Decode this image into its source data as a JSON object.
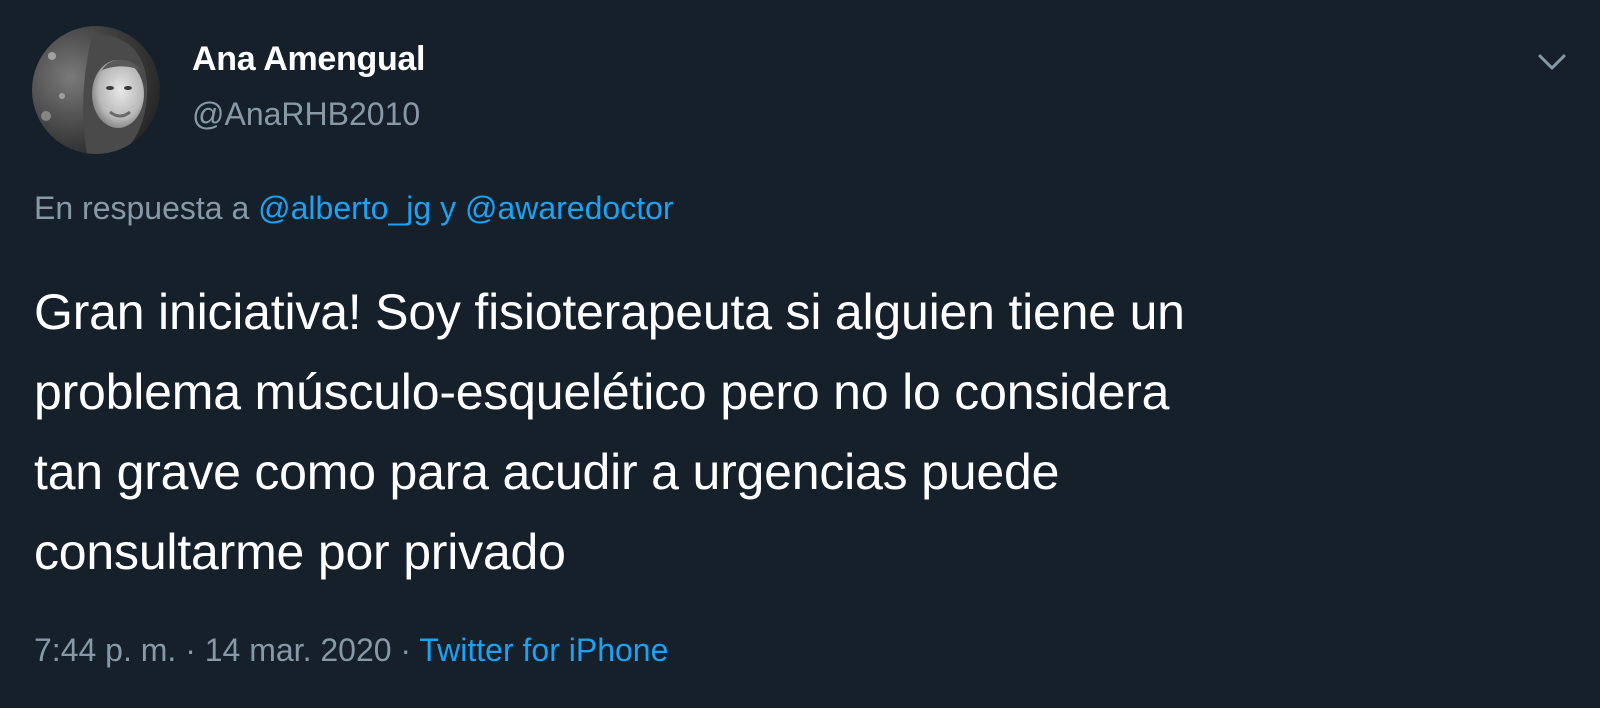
{
  "tweet": {
    "author": {
      "display_name": "Ana Amengual",
      "handle": "@AnaRHB2010"
    },
    "reply_context": {
      "prefix": "En respuesta a ",
      "mention_1": "@alberto_jg",
      "joiner": " y ",
      "mention_2": "@awaredoctor"
    },
    "body_lines": [
      "Gran iniciativa! Soy fisioterapeuta si alguien tiene un",
      "problema músculo-esquelético pero no lo considera",
      "tan grave como para acudir a urgencias puede",
      "consultarme por privado"
    ],
    "time": "7:44 p. m.",
    "separator": " · ",
    "date": "14 mar. 2020",
    "source": "Twitter for iPhone"
  },
  "icons": {
    "caret": "chevron-down-icon",
    "avatar": "profile-photo"
  },
  "colors": {
    "background": "#15202b",
    "primary_text": "#ffffff",
    "secondary_text": "#8899a6",
    "accent": "#1da1f2"
  }
}
